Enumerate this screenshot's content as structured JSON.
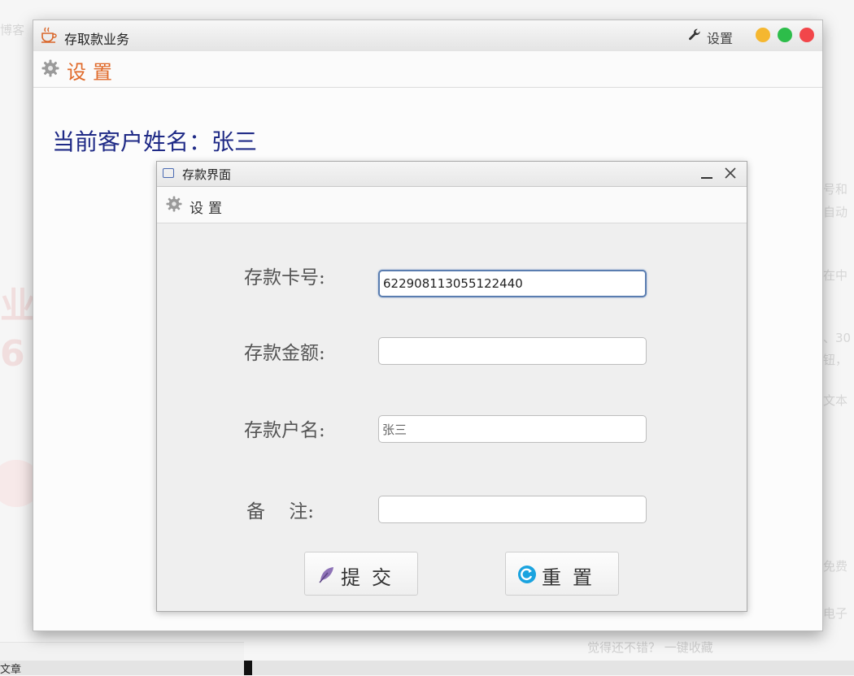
{
  "background": {
    "left_snippets": [
      "博客"
    ],
    "right_snippets": [
      "号和",
      "自动",
      "在中",
      "、30",
      "钮，",
      "文本",
      "免费",
      "电子"
    ],
    "big_left_chars": [
      "业",
      "6"
    ],
    "bottom_left": "文章",
    "bottom_center": "觉得还不错？ 一键收藏"
  },
  "main_window": {
    "title": "存取款业务",
    "settings_label": "设置",
    "menu_label": "设置",
    "customer_label": "当前客户姓名：张三"
  },
  "dialog": {
    "title": "存款界面",
    "menu_label": "设置",
    "fields": [
      {
        "label": "存款卡号:",
        "value": ""
      },
      {
        "label": "存款金额:",
        "value": ""
      },
      {
        "label": "存款户名:",
        "value": "张三"
      },
      {
        "label": "备    注:",
        "value": ""
      }
    ],
    "card_value": "622908113055122440",
    "amount_value": "",
    "name_value": "张三",
    "remark_value": "",
    "submit_label": "提交",
    "reset_label": "重置"
  },
  "colors": {
    "accent_orange": "#e06a2a",
    "customer_text": "#1f2a86",
    "dot_yellow": "#f5b730",
    "dot_green": "#2dbd4a",
    "dot_red": "#f2464a"
  },
  "icons": [
    "coffee-cup-icon",
    "wrench-icon",
    "gear-icon",
    "window-icon",
    "minimize-icon",
    "close-icon",
    "feather-icon",
    "refresh-icon"
  ]
}
